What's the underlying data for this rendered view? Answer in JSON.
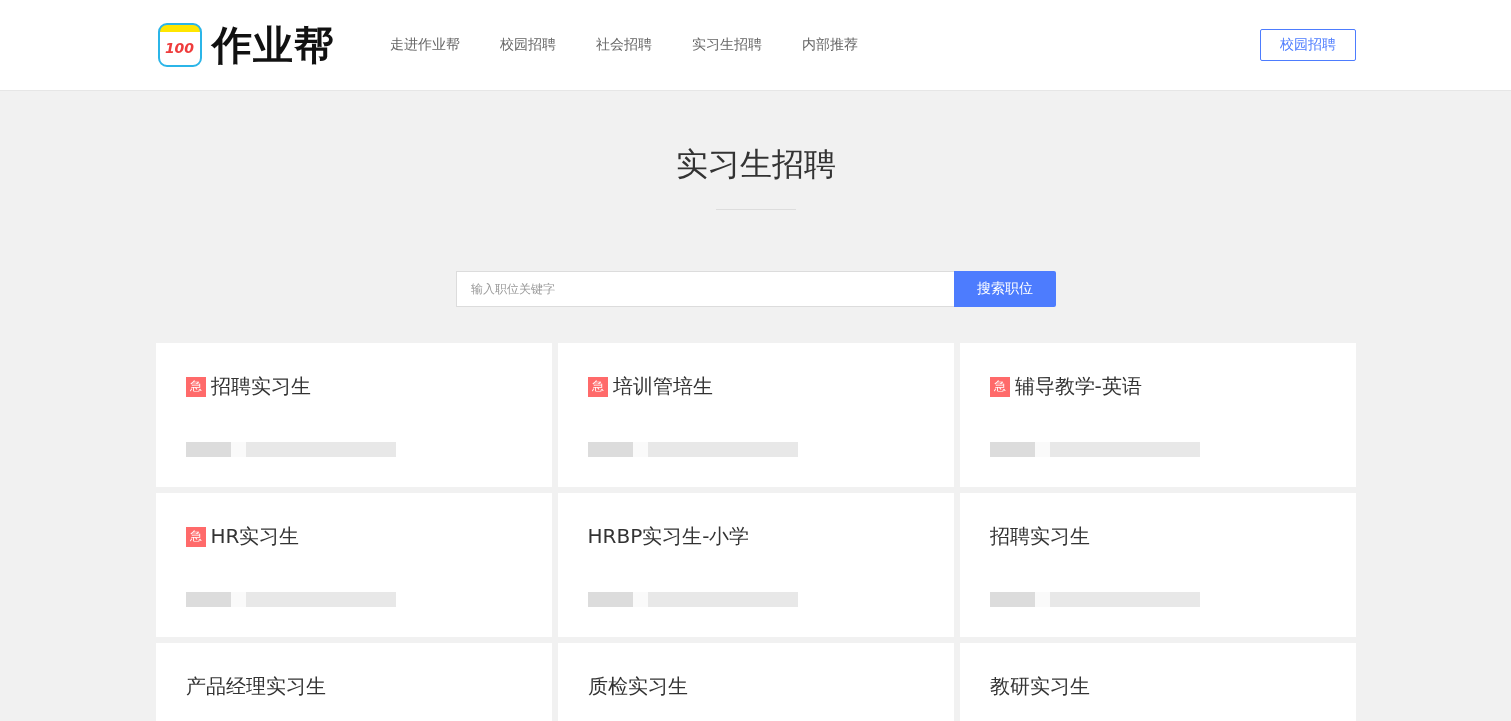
{
  "header": {
    "logo_badge": "100",
    "logo_text": "作业帮",
    "nav": [
      {
        "label": "走进作业帮",
        "selected": false
      },
      {
        "label": "校园招聘",
        "selected": false
      },
      {
        "label": "社会招聘",
        "selected": false
      },
      {
        "label": "实习生招聘",
        "selected": false
      },
      {
        "label": "内部推荐",
        "selected": false
      }
    ],
    "action_button": "校园招聘"
  },
  "page_title": "实习生招聘",
  "search": {
    "placeholder": "输入职位关键字",
    "button": "搜索职位"
  },
  "jobs": [
    {
      "title": "招聘实习生",
      "urgent": true,
      "urgent_label": "急"
    },
    {
      "title": "培训管培生",
      "urgent": true,
      "urgent_label": "急"
    },
    {
      "title": "辅导教学-英语",
      "urgent": true,
      "urgent_label": "急"
    },
    {
      "title": "HR实习生",
      "urgent": true,
      "urgent_label": "急"
    },
    {
      "title": "HRBP实习生-小学",
      "urgent": false
    },
    {
      "title": "招聘实习生",
      "urgent": false
    },
    {
      "title": "产品经理实习生",
      "urgent": false
    },
    {
      "title": "质检实习生",
      "urgent": false
    },
    {
      "title": "教研实习生",
      "urgent": false
    }
  ]
}
